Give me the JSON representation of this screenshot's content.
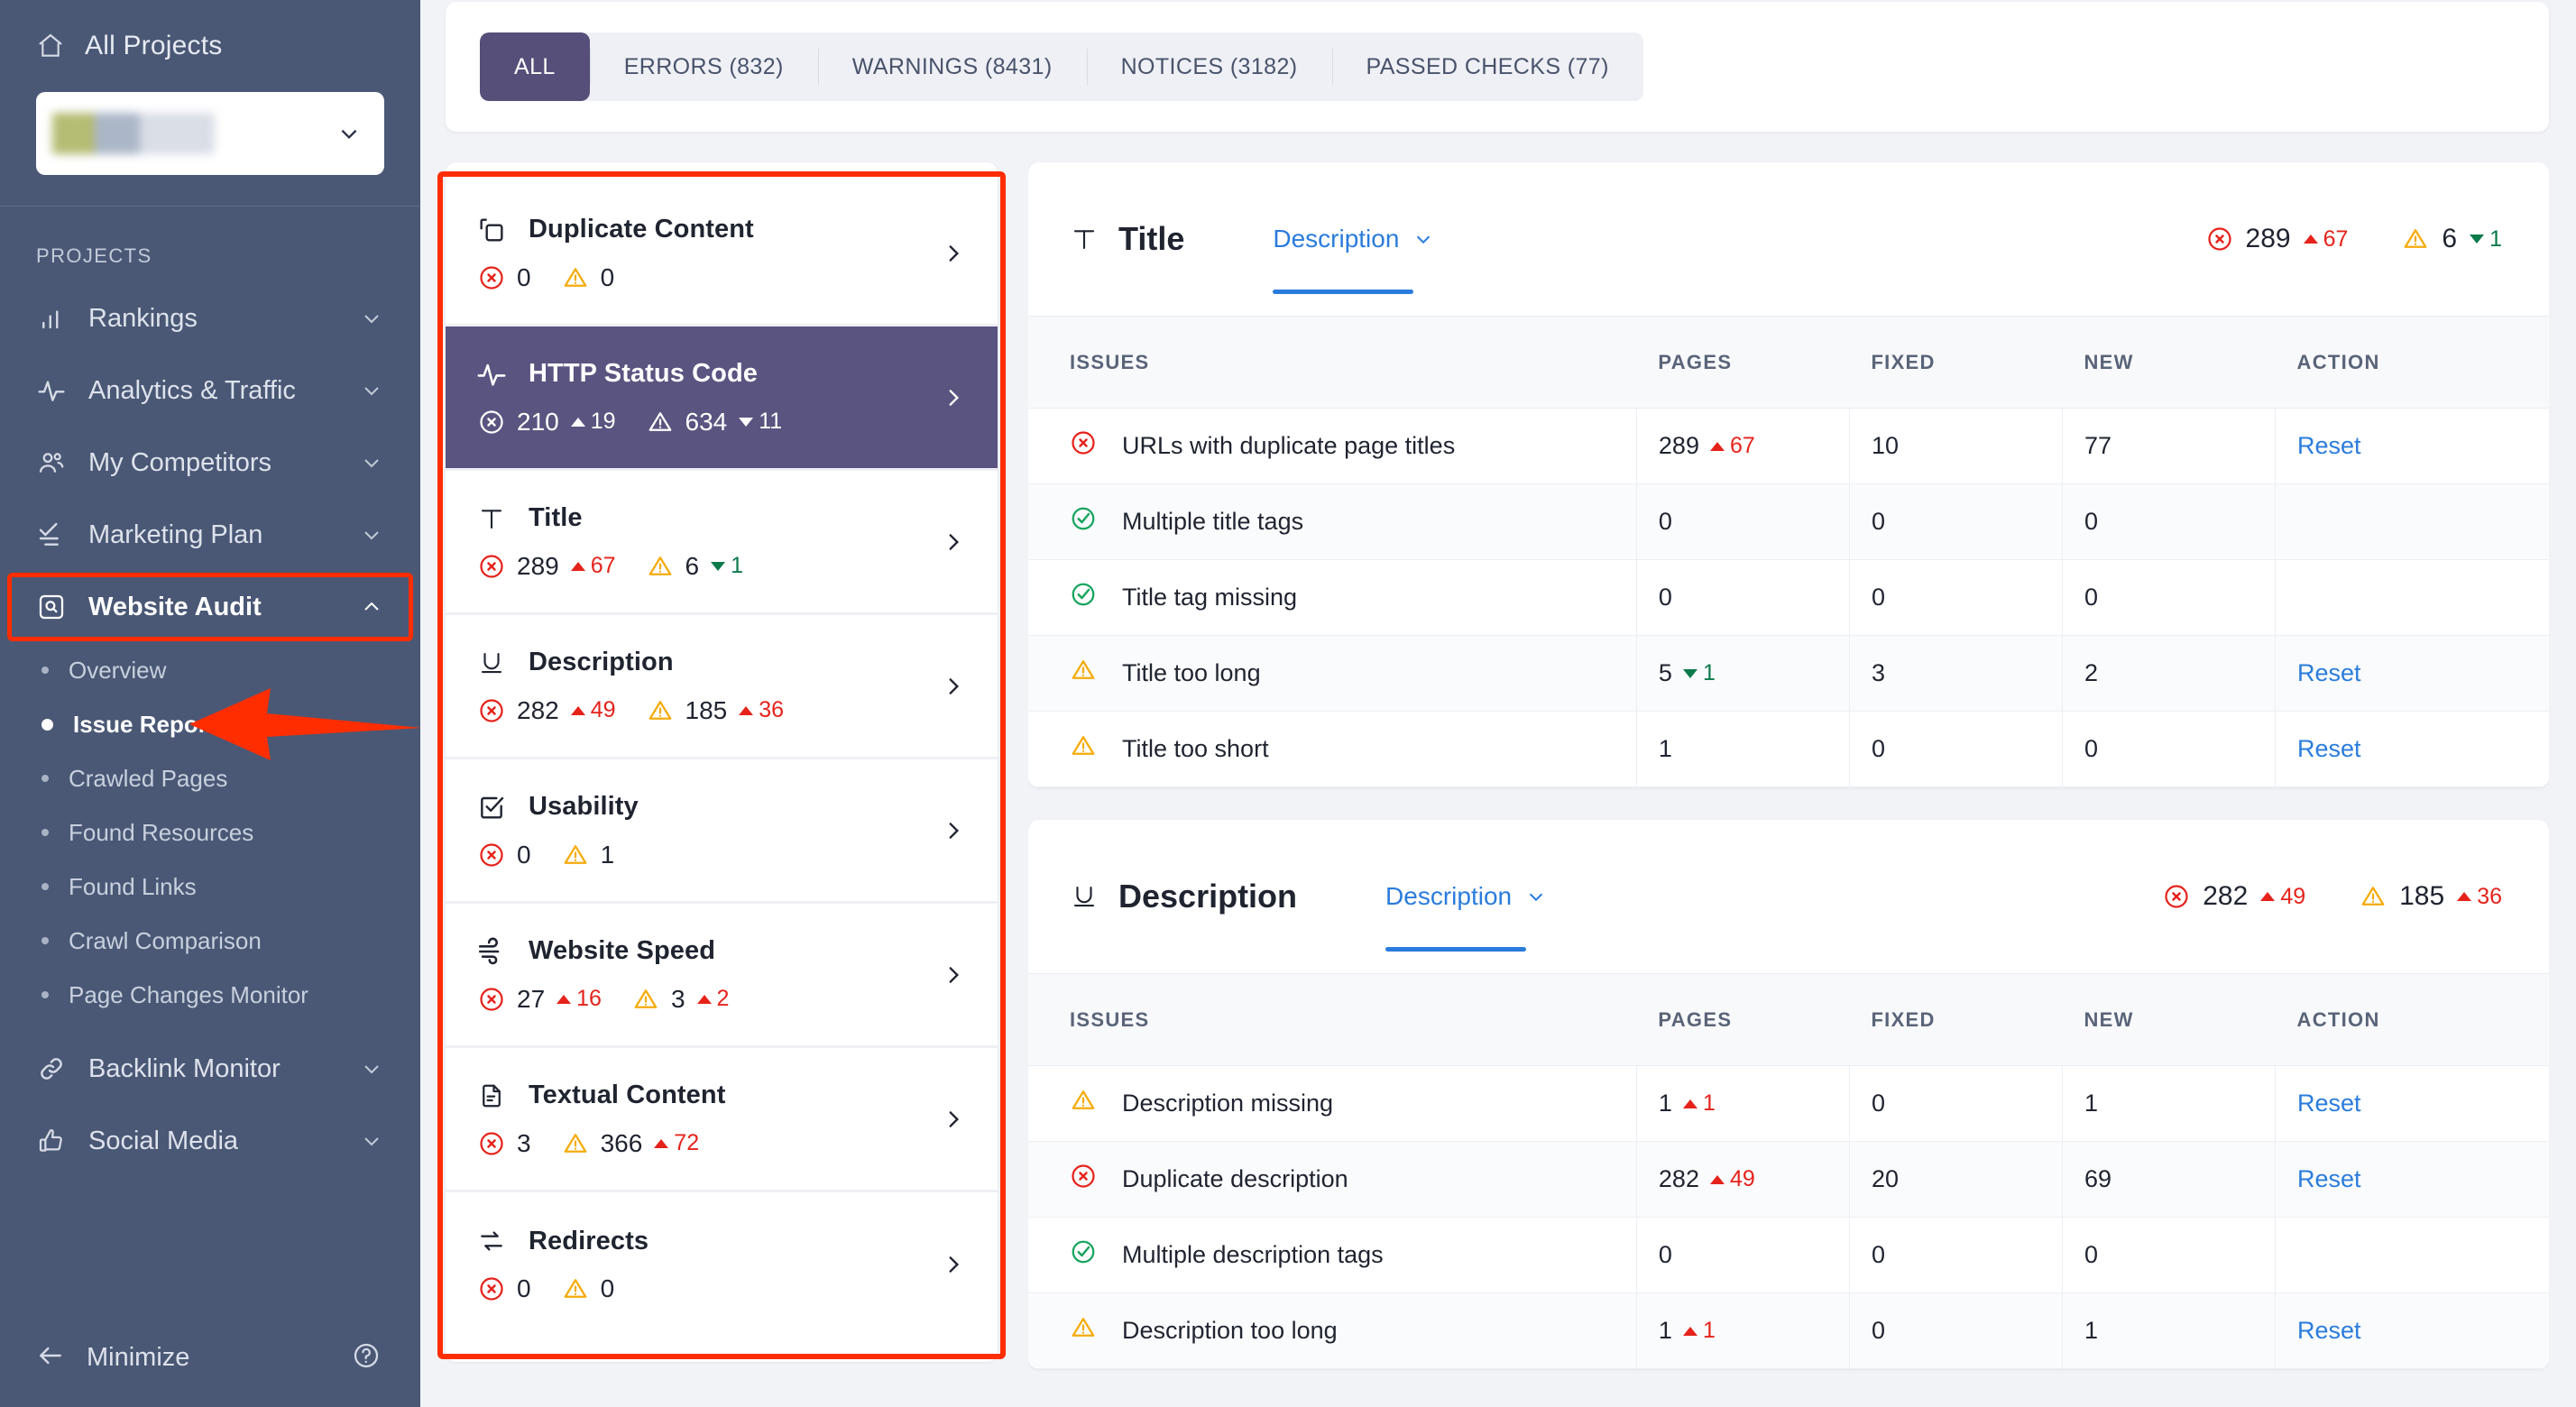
{
  "sidebar": {
    "all_projects_label": "All Projects",
    "project_selected": "",
    "section_label": "PROJECTS",
    "nav": [
      {
        "label": "Rankings",
        "icon": "bar-chart-icon",
        "expandable": true
      },
      {
        "label": "Analytics & Traffic",
        "icon": "pulse-icon",
        "expandable": true
      },
      {
        "label": "My Competitors",
        "icon": "people-icon",
        "expandable": true
      },
      {
        "label": "Marketing Plan",
        "icon": "checklist-icon",
        "expandable": true
      },
      {
        "label": "Website Audit",
        "icon": "magnify-box-icon",
        "expandable": true,
        "active": true
      }
    ],
    "sub_items": [
      {
        "label": "Overview",
        "active": false
      },
      {
        "label": "Issue Report",
        "active": true
      },
      {
        "label": "Crawled Pages",
        "active": false
      },
      {
        "label": "Found Resources",
        "active": false
      },
      {
        "label": "Found Links",
        "active": false
      },
      {
        "label": "Crawl Comparison",
        "active": false
      },
      {
        "label": "Page Changes Monitor",
        "active": false
      }
    ],
    "nav_after": [
      {
        "label": "Backlink Monitor",
        "icon": "link-icon",
        "expandable": true
      },
      {
        "label": "Social Media",
        "icon": "thumbs-up-icon",
        "expandable": true
      }
    ],
    "minimize_label": "Minimize",
    "help_icon": "question-circle-icon"
  },
  "tabs": [
    {
      "label": "ALL",
      "active": true
    },
    {
      "label": "ERRORS (832)",
      "active": false
    },
    {
      "label": "WARNINGS (8431)",
      "active": false
    },
    {
      "label": "NOTICES (3182)",
      "active": false
    },
    {
      "label": "PASSED CHECKS (77)",
      "active": false
    }
  ],
  "categories": [
    {
      "name": "Duplicate Content",
      "icon": "copy-icon",
      "active": false,
      "errors": "0",
      "error_delta": "",
      "error_delta_dir": "",
      "warnings": "0",
      "warning_delta": "",
      "warning_delta_dir": ""
    },
    {
      "name": "HTTP Status Code",
      "icon": "pulse-icon",
      "active": true,
      "errors": "210",
      "error_delta": "19",
      "error_delta_dir": "up",
      "warnings": "634",
      "warning_delta": "11",
      "warning_delta_dir": "down"
    },
    {
      "name": "Title",
      "icon": "title-t-icon",
      "active": false,
      "errors": "289",
      "error_delta": "67",
      "error_delta_dir": "up",
      "warnings": "6",
      "warning_delta": "1",
      "warning_delta_dir": "down"
    },
    {
      "name": "Description",
      "icon": "underline-u-icon",
      "active": false,
      "errors": "282",
      "error_delta": "49",
      "error_delta_dir": "up",
      "warnings": "185",
      "warning_delta": "36",
      "warning_delta_dir": "up"
    },
    {
      "name": "Usability",
      "icon": "checkbox-icon",
      "active": false,
      "errors": "0",
      "error_delta": "",
      "error_delta_dir": "",
      "warnings": "1",
      "warning_delta": "",
      "warning_delta_dir": ""
    },
    {
      "name": "Website Speed",
      "icon": "wind-icon",
      "active": false,
      "errors": "27",
      "error_delta": "16",
      "error_delta_dir": "up",
      "warnings": "3",
      "warning_delta": "2",
      "warning_delta_dir": "up"
    },
    {
      "name": "Textual Content",
      "icon": "document-icon",
      "active": false,
      "errors": "3",
      "error_delta": "",
      "error_delta_dir": "",
      "warnings": "366",
      "warning_delta": "72",
      "warning_delta_dir": "up"
    },
    {
      "name": "Redirects",
      "icon": "redirect-arrows-icon",
      "active": false,
      "errors": "0",
      "error_delta": "",
      "error_delta_dir": "",
      "warnings": "0",
      "warning_delta": "",
      "warning_delta_dir": ""
    }
  ],
  "panels": [
    {
      "title": "Title",
      "icon": "title-t-icon",
      "dropdown_label": "Description",
      "errors": "289",
      "error_delta": "67",
      "error_delta_dir": "up",
      "warnings": "6",
      "warning_delta": "1",
      "warning_delta_dir": "down",
      "columns": [
        "ISSUES",
        "PAGES",
        "FIXED",
        "NEW",
        "ACTION"
      ],
      "rows": [
        {
          "status": "error",
          "issue": "URLs with duplicate page titles",
          "pages": "289",
          "pages_delta": "67",
          "pages_delta_dir": "up",
          "fixed": "10",
          "new": "77",
          "action": "Reset"
        },
        {
          "status": "ok",
          "issue": "Multiple title tags",
          "pages": "0",
          "pages_delta": "",
          "pages_delta_dir": "",
          "fixed": "0",
          "new": "0",
          "action": ""
        },
        {
          "status": "ok",
          "issue": "Title tag missing",
          "pages": "0",
          "pages_delta": "",
          "pages_delta_dir": "",
          "fixed": "0",
          "new": "0",
          "action": ""
        },
        {
          "status": "warning",
          "issue": "Title too long",
          "pages": "5",
          "pages_delta": "1",
          "pages_delta_dir": "down",
          "fixed": "3",
          "new": "2",
          "action": "Reset"
        },
        {
          "status": "warning",
          "issue": "Title too short",
          "pages": "1",
          "pages_delta": "",
          "pages_delta_dir": "",
          "fixed": "0",
          "new": "0",
          "action": "Reset"
        }
      ]
    },
    {
      "title": "Description",
      "icon": "underline-u-icon",
      "dropdown_label": "Description",
      "errors": "282",
      "error_delta": "49",
      "error_delta_dir": "up",
      "warnings": "185",
      "warning_delta": "36",
      "warning_delta_dir": "up",
      "columns": [
        "ISSUES",
        "PAGES",
        "FIXED",
        "NEW",
        "ACTION"
      ],
      "rows": [
        {
          "status": "warning",
          "issue": "Description missing",
          "pages": "1",
          "pages_delta": "1",
          "pages_delta_dir": "up",
          "fixed": "0",
          "new": "1",
          "action": "Reset"
        },
        {
          "status": "error",
          "issue": "Duplicate description",
          "pages": "282",
          "pages_delta": "49",
          "pages_delta_dir": "up",
          "fixed": "20",
          "new": "69",
          "action": "Reset"
        },
        {
          "status": "ok",
          "issue": "Multiple description tags",
          "pages": "0",
          "pages_delta": "",
          "pages_delta_dir": "",
          "fixed": "0",
          "new": "0",
          "action": ""
        },
        {
          "status": "warning",
          "issue": "Description too long",
          "pages": "1",
          "pages_delta": "1",
          "pages_delta_dir": "up",
          "fixed": "0",
          "new": "1",
          "action": "Reset"
        }
      ]
    }
  ],
  "colors": {
    "sidebar_bg": "#4a5875",
    "accent_purple": "#564f79",
    "error_red": "#e5231b",
    "warning_yellow": "#f5ab0a",
    "ok_green": "#18a45f",
    "link_blue": "#2a7cdc",
    "annotation_red": "#ff2d00"
  }
}
